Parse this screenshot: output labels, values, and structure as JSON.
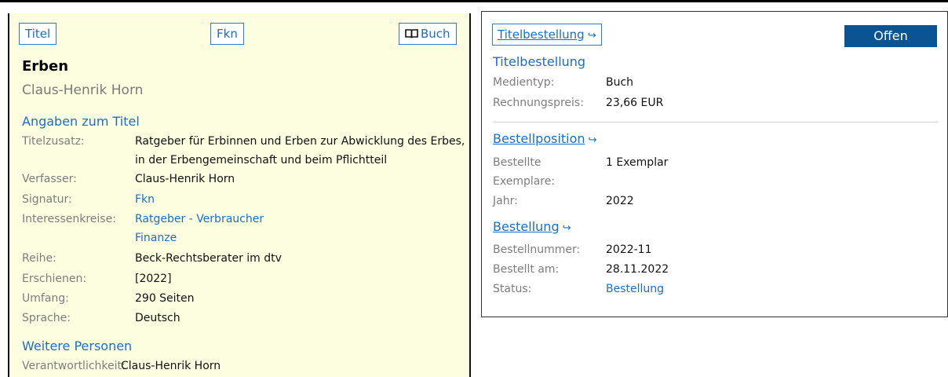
{
  "left": {
    "buttons": {
      "titel": "Titel",
      "fkn": "Fkn",
      "buch": "Buch"
    },
    "title": "Erben",
    "author": "Claus-Henrik Horn",
    "section_title_info": "Angaben zum Titel",
    "section_persons": "Weitere Personen",
    "fields": {
      "titelzusatz_label": "Titelzusatz:",
      "titelzusatz_value": "Ratgeber für Erbinnen und Erben zur Abwicklung des Erbes, in der Erbengemeinschaft und beim Pflichtteil",
      "verfasser_label": "Verfasser:",
      "verfasser_value": "Claus-Henrik Horn",
      "signatur_label": "Signatur:",
      "signatur_value": "Fkn",
      "interessen_label": "Interessenkreise:",
      "interessen_value_1": "Ratgeber - Verbraucher",
      "interessen_value_2": "Finanze",
      "reihe_label": "Reihe:",
      "reihe_value": "Beck-Rechtsberater im dtv",
      "erschienen_label": "Erschienen:",
      "erschienen_value": "[2022]",
      "umfang_label": "Umfang:",
      "umfang_value": "290 Seiten",
      "sprache_label": "Sprache:",
      "sprache_value": "Deutsch",
      "verantwortlich_label": "Verantwortlichkeit:",
      "verantwortlich_value": "Claus-Henrik Horn"
    }
  },
  "right": {
    "link_button": "Titelbestellung",
    "status": "Offen",
    "heading": "Titelbestellung",
    "medientyp_label": "Medientyp:",
    "medientyp_value": "Buch",
    "preis_label": "Rechnungspreis:",
    "preis_value": "23,66 EUR",
    "bestellposition_link": "Bestellposition",
    "bestellte_label": "Bestellte Exemplare:",
    "bestellte_value": "1 Exemplar",
    "jahr_label": "Jahr:",
    "jahr_value": "2022",
    "bestellung_link": "Bestellung",
    "bestellnummer_label": "Bestellnummer:",
    "bestellnummer_value": "2022-11",
    "bestellt_am_label": "Bestellt am:",
    "bestellt_am_value": "28.11.2022",
    "status_label": "Status:",
    "status_value": "Bestellung"
  },
  "icons": {
    "link_arrow": "external-link-arrow-icon",
    "book": "open-book-icon"
  },
  "colors": {
    "accent": "#1b6ec7",
    "status_bg": "#0a5494",
    "panel_bg": "#fdfde0"
  }
}
